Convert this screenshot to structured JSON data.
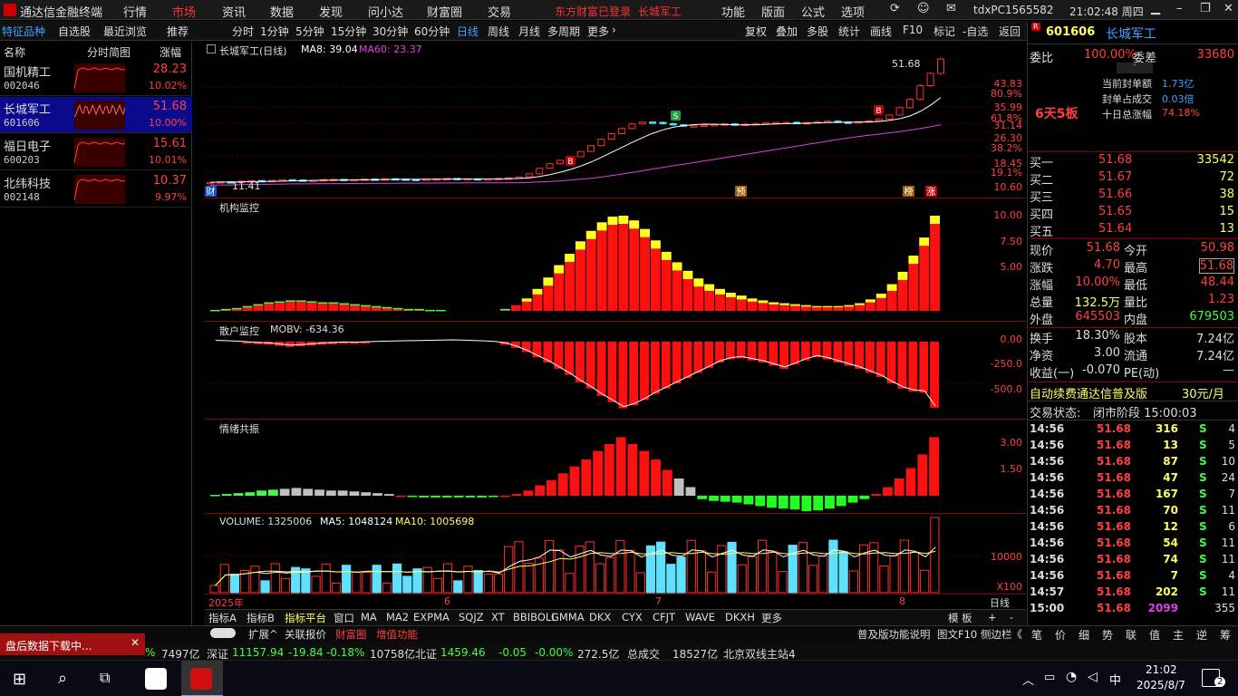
{
  "app": {
    "title": "通达信金融终端",
    "login_status": "东方财富已登录",
    "stock_title": "长城军工",
    "menus": [
      "行情",
      "市场",
      "资讯",
      "数据",
      "发现",
      "问小达",
      "财富圈",
      "交易"
    ],
    "menus_right": [
      "功能",
      "版面",
      "公式",
      "选项"
    ],
    "account": "tdxPC1565582",
    "time": "21:02:48 周四"
  },
  "toolbar": {
    "left_tabs": [
      "特征品种",
      "自选股",
      "最近浏览",
      "推荐"
    ],
    "periods": [
      "分时",
      "1分钟",
      "5分钟",
      "15分钟",
      "30分钟",
      "60分钟",
      "日线",
      "周线",
      "月线",
      "多周期",
      "更多"
    ],
    "tools": [
      "复权",
      "叠加",
      "多股",
      "统计",
      "画线",
      "F10",
      "-自选",
      "返回"
    ]
  },
  "left_panel": {
    "headers": [
      "名称",
      "分时简图",
      "涨幅"
    ],
    "stocks": [
      {
        "name": "国机精工",
        "code": "002046",
        "price": "28.23",
        "pct": "10.02%"
      },
      {
        "name": "长城军工",
        "code": "601606",
        "price": "51.68",
        "pct": "10.00%"
      },
      {
        "name": "福日电子",
        "code": "600203",
        "price": "15.61",
        "pct": "10.01%"
      },
      {
        "name": "北纬科技",
        "code": "002148",
        "price": "10.37",
        "pct": "9.97%"
      }
    ]
  },
  "chart": {
    "main_label": "长城军工(日线)",
    "ma8_label": "MA8: 39.04",
    "ma60_label": "MA60: 23.37",
    "high_label": "51.68",
    "low_label": "11.41",
    "axis_main": [
      "43.83",
      "80.9%",
      "35.99",
      "61.8%",
      "31.14",
      "26.30",
      "38.2%",
      "18.45",
      "19.1%",
      "10.60"
    ],
    "marks": {
      "b": "B",
      "s": "S",
      "yu": "预",
      "bang": "榜",
      "zhang": "涨",
      "cai": "财"
    },
    "p2_label": "机构监控",
    "p2_axis": [
      "10.00",
      "7.50",
      "5.00"
    ],
    "p3_label": "散户监控",
    "p3_value": "MOBV: -634.36",
    "p3_axis": [
      "0.00",
      "-250.0",
      "-500.0"
    ],
    "p4_label": "情绪共振",
    "p4_axis": [
      "3.00",
      "1.50"
    ],
    "p5_label": "VOLUME: 1325006",
    "p5_ma5": "MA5: 1048124",
    "p5_ma10": "MA10: 1005698",
    "p5_axis": [
      "10000",
      "X100"
    ],
    "xaxis": [
      "2025年",
      "6",
      "7",
      "8"
    ],
    "xaxis_right": "日线",
    "chart_data": {
      "type": "candlestick",
      "xlabels": [
        "2025年",
        "6",
        "7",
        "8"
      ],
      "close": [
        11.41,
        11.6,
        11.5,
        11.8,
        12.0,
        11.9,
        12.1,
        12.3,
        12.2,
        12.0,
        12.1,
        12.3,
        12.4,
        12.2,
        12.3,
        12.5,
        12.4,
        12.6,
        12.5,
        12.4,
        12.3,
        12.5,
        12.6,
        12.7,
        12.5,
        12.6,
        12.4,
        12.5,
        12.7,
        12.9,
        13.2,
        14.2,
        16.0,
        17.5,
        18.6,
        19.8,
        21.5,
        23.4,
        25.5,
        27.3,
        29.0,
        30.5,
        31.1,
        31.0,
        30.6,
        30.2,
        29.8,
        29.9,
        30.1,
        30.3,
        30.5,
        30.2,
        30.4,
        30.6,
        30.8,
        30.9,
        31.0,
        30.8,
        30.9,
        31.2,
        31.4,
        31.1,
        31.0,
        31.2,
        31.5,
        32.1,
        33.4,
        35.8,
        38.5,
        43.0,
        46.99,
        51.68
      ]
    }
  },
  "tabs": {
    "left": [
      "指标A",
      "指标B",
      "指标平台",
      "窗口",
      "MA",
      "MA2",
      "EXPMA",
      "SQJZ",
      "XT",
      "BBIBOLL",
      "GMMA",
      "DKX",
      "CYX",
      "CFJT",
      "WAVE",
      "DKXH",
      "更多"
    ],
    "extra": [
      "扩展^",
      "关联报价",
      "财富圈",
      "增值功能"
    ],
    "right": [
      "模 板",
      "+",
      "-"
    ],
    "status_right": "普及版功能说明",
    "f10": "图文F10",
    "side": "侧边栏《",
    "side_tabs": [
      "笔",
      "价",
      "细",
      "势",
      "联",
      "值",
      "主",
      "逆",
      "筹"
    ]
  },
  "right_panel": {
    "code": "601606",
    "name": "长城军工",
    "weibi": "委比",
    "weibi_pct": "100.00%",
    "weicha": "委差",
    "weicha_val": "33680",
    "seal_amount_label": "当前封单额",
    "seal_amount": "1.73亿",
    "seal_ratio_label": "封单占成交",
    "seal_ratio": "0.03倍",
    "ten_day_label": "十日总涨幅",
    "ten_day": "74.18%",
    "limit_streak": "6天5板",
    "bids": [
      {
        "label": "买一",
        "price": "51.68",
        "vol": "33542"
      },
      {
        "label": "买二",
        "price": "51.67",
        "vol": "72"
      },
      {
        "label": "买三",
        "price": "51.66",
        "vol": "38"
      },
      {
        "label": "买四",
        "price": "51.65",
        "vol": "15"
      },
      {
        "label": "买五",
        "price": "51.64",
        "vol": "13"
      }
    ],
    "quote": [
      [
        "现价",
        "51.68",
        "今开",
        "50.98"
      ],
      [
        "涨跌",
        "4.70",
        "最高",
        "51.68"
      ],
      [
        "涨幅",
        "10.00%",
        "最低",
        "48.44"
      ],
      [
        "总量",
        "132.5万",
        "量比",
        "1.23"
      ],
      [
        "外盘",
        "645503",
        "内盘",
        "679503"
      ]
    ],
    "stats": [
      [
        "换手",
        "18.30%",
        "股本",
        "7.24亿"
      ],
      [
        "净资",
        "3.00",
        "流通",
        "7.24亿"
      ],
      [
        "收益(一)",
        "-0.070",
        "PE(动)",
        "—"
      ]
    ],
    "promo": "自动续费通达信普及版",
    "promo_price": "30元/月",
    "trade_status_label": "交易状态:",
    "trade_status": "闭市阶段 15:00:03",
    "ticks": [
      [
        "14:56",
        "51.68",
        "316",
        "S",
        "4"
      ],
      [
        "14:56",
        "51.68",
        "13",
        "S",
        "5"
      ],
      [
        "14:56",
        "51.68",
        "87",
        "S",
        "10"
      ],
      [
        "14:56",
        "51.68",
        "47",
        "S",
        "24"
      ],
      [
        "14:56",
        "51.68",
        "167",
        "S",
        "7"
      ],
      [
        "14:56",
        "51.68",
        "70",
        "S",
        "11"
      ],
      [
        "14:56",
        "51.68",
        "12",
        "S",
        "6"
      ],
      [
        "14:56",
        "51.68",
        "54",
        "S",
        "11"
      ],
      [
        "14:56",
        "51.68",
        "74",
        "S",
        "11"
      ],
      [
        "14:56",
        "51.68",
        "7",
        "S",
        "4"
      ],
      [
        "14:57",
        "51.68",
        "202",
        "S",
        "11"
      ],
      [
        "15:00",
        "51.68",
        "2099",
        "",
        "355"
      ]
    ]
  },
  "status": {
    "download": "盘后数据下载中...",
    "sh_vol": "7497亿",
    "sz_label": "深证",
    "sz_val": "11157.94",
    "sz_chg": "-19.84",
    "sz_pct": "-0.18%",
    "sz_vol": "10758亿",
    "bz_label": "北证",
    "bz_val": "1459.46",
    "bz_chg": "-0.05",
    "bz_pct": "-0.00%",
    "bz_vol": "272.5亿",
    "total_label": "总成交",
    "total": "18527亿",
    "server": "北京双线主站4",
    "pct_prefix": "%"
  },
  "taskbar": {
    "time": "21:02",
    "date": "2025/8/7",
    "ime": "中",
    "notif": "2"
  }
}
